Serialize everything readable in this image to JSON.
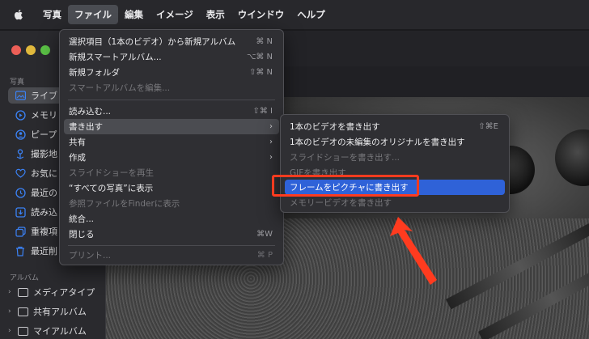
{
  "menubar": {
    "items": [
      "写真",
      "ファイル",
      "編集",
      "イメージ",
      "表示",
      "ウインドウ",
      "ヘルプ"
    ]
  },
  "sidebar": {
    "section_photos": "写真",
    "items": [
      {
        "label": "ライブ",
        "icon": "library-icon"
      },
      {
        "label": "メモリ",
        "icon": "memories-icon"
      },
      {
        "label": "ピープ",
        "icon": "people-icon"
      },
      {
        "label": "撮影地",
        "icon": "places-icon"
      },
      {
        "label": "お気に",
        "icon": "heart-icon"
      },
      {
        "label": "最近の",
        "icon": "recent-icon"
      },
      {
        "label": "読み込",
        "icon": "import-icon"
      },
      {
        "label": "重複項",
        "icon": "duplicate-icon"
      },
      {
        "label": "最近削",
        "icon": "trash-icon"
      }
    ],
    "section_albums": "アルバム",
    "albums": [
      "メディアタイプ",
      "共有アルバム",
      "マイアルバム"
    ]
  },
  "file_menu": {
    "items": [
      {
        "label": "選択項目（1本のビデオ）から新規アルバム",
        "shortcut": "⌘ N"
      },
      {
        "label": "新規スマートアルバム...",
        "shortcut": "⌥⌘ N"
      },
      {
        "label": "新規フォルダ",
        "shortcut": "⇧⌘ N"
      },
      {
        "label": "スマートアルバムを編集...",
        "shortcut": ""
      },
      {
        "label": "読み込む...",
        "shortcut": "⇧⌘ I"
      },
      {
        "label": "書き出す",
        "shortcut": "›"
      },
      {
        "label": "共有",
        "shortcut": "›"
      },
      {
        "label": "作成",
        "shortcut": "›"
      },
      {
        "label": "スライドショーを再生",
        "shortcut": ""
      },
      {
        "label": "“すべての写真”に表示",
        "shortcut": ""
      },
      {
        "label": "参照ファイルをFinderに表示",
        "shortcut": ""
      },
      {
        "label": "統合...",
        "shortcut": ""
      },
      {
        "label": "閉じる",
        "shortcut": "⌘W"
      },
      {
        "label": "プリント...",
        "shortcut": "⌘ P"
      }
    ]
  },
  "export_menu": {
    "items": [
      {
        "label": "1本のビデオを書き出す",
        "shortcut": "⇧⌘E"
      },
      {
        "label": "1本のビデオの未編集のオリジナルを書き出す",
        "shortcut": ""
      },
      {
        "label": "スライドショーを書き出す...",
        "shortcut": ""
      },
      {
        "label": "GIFを書き出す",
        "shortcut": ""
      },
      {
        "label": "フレームをピクチャに書き出す",
        "shortcut": ""
      },
      {
        "label": "メモリービデオを書き出す",
        "shortcut": ""
      }
    ]
  },
  "colors": {
    "highlight": "#2f62d8",
    "annotation": "#ff3b1f"
  }
}
